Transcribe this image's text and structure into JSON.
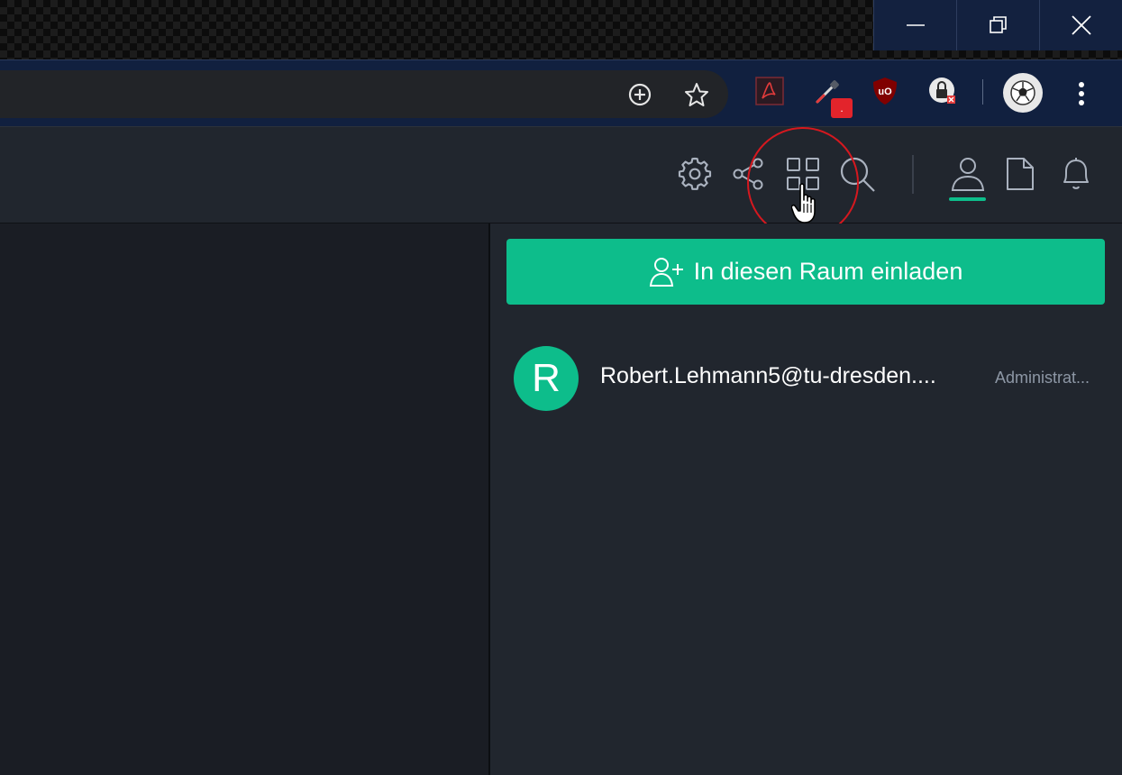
{
  "window_controls": {
    "minimize_icon": "minimize-icon",
    "restore_icon": "restore-icon",
    "close_icon": "close-icon",
    "background": "#13213f"
  },
  "browser_toolbar": {
    "omnibox_icons": [
      "zoom-in-icon",
      "bookmark-star-icon"
    ],
    "extensions": [
      "acrobat-icon",
      "eyedropper-extension-icon",
      "ublock-origin-icon",
      "lock-extension-icon"
    ],
    "eyedropper_badge": ".",
    "profile_icon": "profile-avatar-soccer-ball-icon",
    "menu_icon": "more-vertical-icon",
    "background": "#11203f"
  },
  "room_header": {
    "icons": [
      "settings-gear-icon",
      "share-icon",
      "widgets-grid-icon",
      "search-icon",
      "people-icon",
      "files-icon",
      "notifications-bell-icon"
    ],
    "active": "people-icon",
    "highlighted": "widgets-grid-icon",
    "accent": "#0dbd8b",
    "highlight_color": "#d5181f"
  },
  "right_panel": {
    "invite_button_label": "In diesen Raum einladen",
    "invite_icon": "add-user-icon",
    "members": [
      {
        "avatar_letter": "R",
        "name": "Robert.Lehmann5@tu-dresden....",
        "role": "Administrat..."
      }
    ]
  },
  "colors": {
    "app_background": "#21262e",
    "left_pane_background": "#1a1d24",
    "accent": "#0dbd8b",
    "muted_text": "#8d97a5"
  }
}
